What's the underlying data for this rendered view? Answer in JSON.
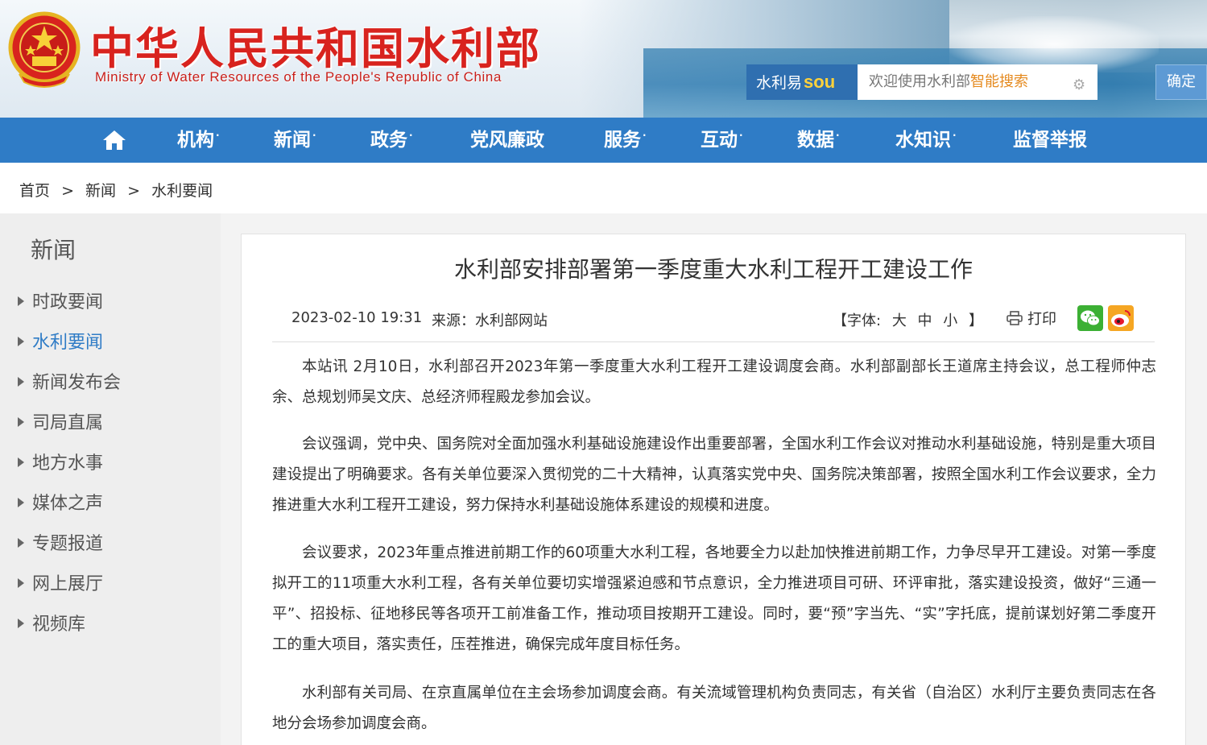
{
  "header": {
    "title": "中华人民共和国水利部",
    "subtitle": "Ministry of Water Resources of the People's Republic of China"
  },
  "search": {
    "brand": "水利易",
    "brand_sou": "sou",
    "placeholder_pre": "欢迎使用水利部",
    "placeholder_hl": "智能搜索",
    "button": "确定"
  },
  "nav": {
    "items": [
      "机构",
      "新闻",
      "政务",
      "党风廉政",
      "服务",
      "互动",
      "数据",
      "水知识",
      "监督举报"
    ],
    "dot": "·"
  },
  "breadcrumb": {
    "home": "首页",
    "sep": ">",
    "news": "新闻",
    "current": "水利要闻"
  },
  "sidebar": {
    "title": "新闻",
    "items": [
      "时政要闻",
      "水利要闻",
      "新闻发布会",
      "司局直属",
      "地方水事",
      "媒体之声",
      "专题报道",
      "网上展厅",
      "视频库"
    ]
  },
  "article": {
    "title": "水利部安排部署第一季度重大水利工程开工建设工作",
    "date": "2023-02-10 19:31",
    "source": "来源：水利部网站",
    "font_label": "【字体:",
    "font_large": "大",
    "font_medium": "中",
    "font_small": "小",
    "font_close": "】",
    "print": "打印",
    "paragraphs": [
      "本站讯 2月10日，水利部召开2023年第一季度重大水利工程开工建设调度会商。水利部副部长王道席主持会议，总工程师仲志余、总规划师吴文庆、总经济师程殿龙参加会议。",
      "会议强调，党中央、国务院对全面加强水利基础设施建设作出重要部署，全国水利工作会议对推动水利基础设施，特别是重大项目建设提出了明确要求。各有关单位要深入贯彻党的二十大精神，认真落实党中央、国务院决策部署，按照全国水利工作会议要求，全力推进重大水利工程开工建设，努力保持水利基础设施体系建设的规模和进度。",
      "会议要求，2023年重点推进前期工作的60项重大水利工程，各地要全力以赴加快推进前期工作，力争尽早开工建设。对第一季度拟开工的11项重大水利工程，各有关单位要切实增强紧迫感和节点意识，全力推进项目可研、环评审批，落实建设投资，做好“三通一平”、招投标、征地移民等各项开工前准备工作，推动项目按期开工建设。同时，要“预”字当先、“实”字托底，提前谋划好第二季度开工的重大项目，落实责任，压茬推进，确保完成年度目标任务。",
      "水利部有关司局、在京直属单位在主会场参加调度会商。有关流域管理机构负责同志，有关省（自治区）水利厅主要负责同志在各地分会场参加调度会商。"
    ]
  },
  "colors": {
    "nav": "#2f7cc6",
    "title_red": "#d8231e",
    "active": "#2f7cc6"
  }
}
